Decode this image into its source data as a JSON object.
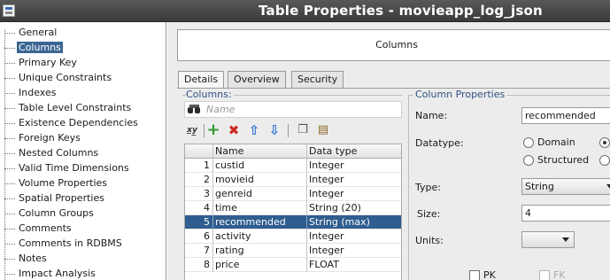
{
  "window": {
    "title": "Table Properties - movieapp_log_json"
  },
  "nav": {
    "items": [
      {
        "label": "General"
      },
      {
        "label": "Columns",
        "selected": true
      },
      {
        "label": "Primary Key"
      },
      {
        "label": "Unique Constraints"
      },
      {
        "label": "Indexes"
      },
      {
        "label": "Table Level Constraints"
      },
      {
        "label": "Existence Dependencies"
      },
      {
        "label": "Foreign Keys"
      },
      {
        "label": "Nested Columns"
      },
      {
        "label": "Valid Time Dimensions"
      },
      {
        "label": "Volume Properties"
      },
      {
        "label": "Spatial Properties"
      },
      {
        "label": "Column Groups"
      },
      {
        "label": "Comments"
      },
      {
        "label": "Comments in RDBMS"
      },
      {
        "label": "Notes"
      },
      {
        "label": "Impact Analysis"
      }
    ]
  },
  "header": {
    "title": "Columns"
  },
  "tabs": [
    {
      "label": "Details",
      "active": true
    },
    {
      "label": "Overview"
    },
    {
      "label": "Security"
    }
  ],
  "columns_panel": {
    "legend": "Columns:",
    "filter_placeholder": "Name",
    "toolbar": {
      "icons": [
        "column-properties-icon",
        "add-icon",
        "delete-icon",
        "move-up-icon",
        "move-down-icon",
        "copy-icon",
        "paste-icon"
      ]
    },
    "grid": {
      "headers": {
        "name": "Name",
        "type": "Data type"
      },
      "rows": [
        {
          "num": "1",
          "name": "custid",
          "type": "Integer"
        },
        {
          "num": "2",
          "name": "movieid",
          "type": "Integer"
        },
        {
          "num": "3",
          "name": "genreid",
          "type": "Integer"
        },
        {
          "num": "4",
          "name": "time",
          "type": "String (20)"
        },
        {
          "num": "5",
          "name": "recommended",
          "type": "String (max)",
          "selected": true
        },
        {
          "num": "6",
          "name": "activity",
          "type": "Integer"
        },
        {
          "num": "7",
          "name": "rating",
          "type": "Integer"
        },
        {
          "num": "8",
          "name": "price",
          "type": "FLOAT"
        }
      ]
    }
  },
  "column_properties": {
    "legend": "Column Properties",
    "name_label": "Name:",
    "name_value": "recommended",
    "datatype_label": "Datatype:",
    "datatype_options": [
      {
        "label": "Domain",
        "checked": false
      },
      {
        "label": "Structured",
        "checked": false
      }
    ],
    "type_label": "Type:",
    "type_value": "String",
    "size_label": "Size:",
    "size_value": "4",
    "units_label": "Units:",
    "units_value": "",
    "pk_label": "PK",
    "fk_label": "FK"
  },
  "colors": {
    "title_bar": "#474747",
    "selection": "#2f5d8f",
    "legend_text": "#2f4f7f"
  }
}
